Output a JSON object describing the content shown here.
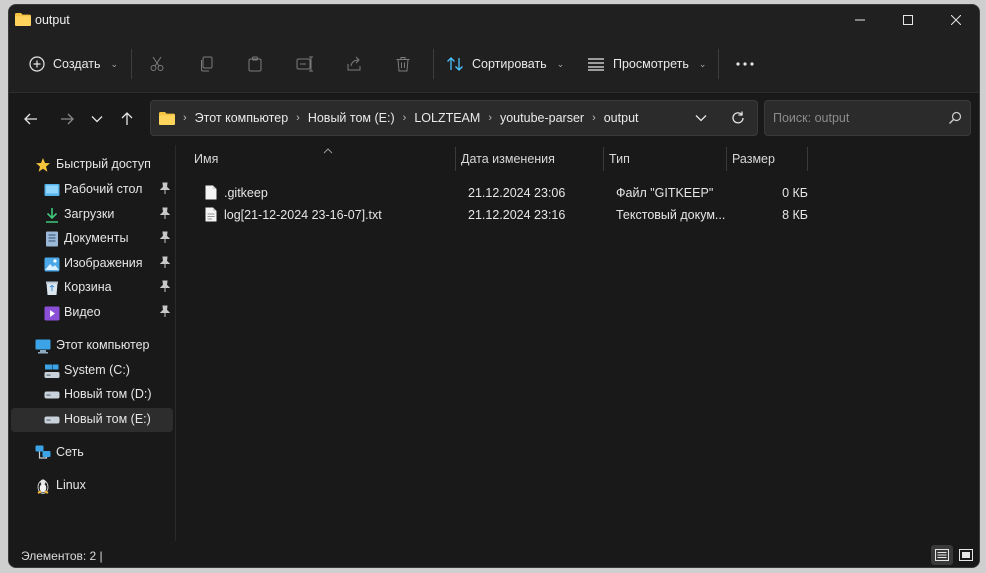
{
  "window": {
    "title": "output"
  },
  "toolbar": {
    "create_label": "Создать",
    "sort_label": "Сортировать",
    "view_label": "Просмотреть"
  },
  "address": {
    "crumbs": [
      "Этот компьютер",
      "Новый том (E:)",
      "LOLZTEAM",
      "youtube-parser",
      "output"
    ]
  },
  "search": {
    "placeholder": "Поиск: output"
  },
  "sidebar": {
    "quick_access": "Быстрый доступ",
    "pinned": [
      "Рабочий стол",
      "Загрузки",
      "Документы",
      "Изображения",
      "Корзина",
      "Видео"
    ],
    "this_pc": "Этот компьютер",
    "drives": [
      "System (C:)",
      "Новый том (D:)",
      "Новый том (E:)"
    ],
    "network": "Сеть",
    "linux": "Linux"
  },
  "columns": {
    "name": "Имя",
    "modified": "Дата изменения",
    "type": "Тип",
    "size": "Размер"
  },
  "files": [
    {
      "name": ".gitkeep",
      "modified": "21.12.2024 23:06",
      "type": "Файл \"GITKEEP\"",
      "size": "0 КБ"
    },
    {
      "name": "log[21-12-2024 23-16-07].txt",
      "modified": "21.12.2024 23:16",
      "type": "Текстовый докум...",
      "size": "8 КБ"
    }
  ],
  "status": {
    "items_count": "Элементов: 2  |"
  },
  "colors": {
    "folder": "#f5c342",
    "accent": "#4cc2ff",
    "background": "#191919"
  }
}
